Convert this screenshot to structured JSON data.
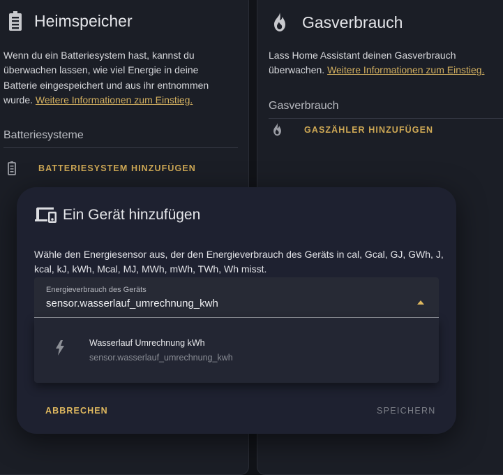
{
  "battery_card": {
    "title": "Heimspeicher",
    "description": "Wenn du ein Batteriesystem hast, kannst du überwachen lassen, wie viel Energie in deine Batterie eingespeichert und aus ihr entnommen wurde.",
    "link": "Weitere Informationen zum Einstieg.",
    "section_label": "Batteriesysteme",
    "add_label": "BATTERIESYSTEM HINZUFÜGEN",
    "icon": "battery-icon"
  },
  "gas_card": {
    "title": "Gasverbrauch",
    "description": "Lass Home Assistant deinen Gasverbrauch überwachen.",
    "link": "Weitere Informationen zum Einstieg.",
    "section_label": "Gasverbrauch",
    "add_label": "GASZÄHLER HINZUFÜGEN",
    "icon": "fire-icon"
  },
  "dialog": {
    "title": "Ein Gerät hinzufügen",
    "description": "Wähle den Energiesensor aus, der den Energieverbrauch des Geräts in cal, Gcal, GJ, GWh, J, kcal, kJ, kWh, Mcal, MJ, MWh, mWh, TWh, Wh misst.",
    "select": {
      "label": "Energieverbrauch des Geräts",
      "value": "sensor.wasserlauf_umrechnung_kwh"
    },
    "options": [
      {
        "primary": "Wasserlauf Umrechnung kWh",
        "secondary": "sensor.wasserlauf_umrechnung_kwh",
        "icon": "flash-icon"
      }
    ],
    "cancel_label": "ABBRECHEN",
    "save_label": "SPEICHERN",
    "icon": "devices-icon"
  },
  "colors": {
    "accent": "#d3b060",
    "background": "#111318",
    "card": "#1b1e26",
    "dialog": "#1e2130"
  }
}
